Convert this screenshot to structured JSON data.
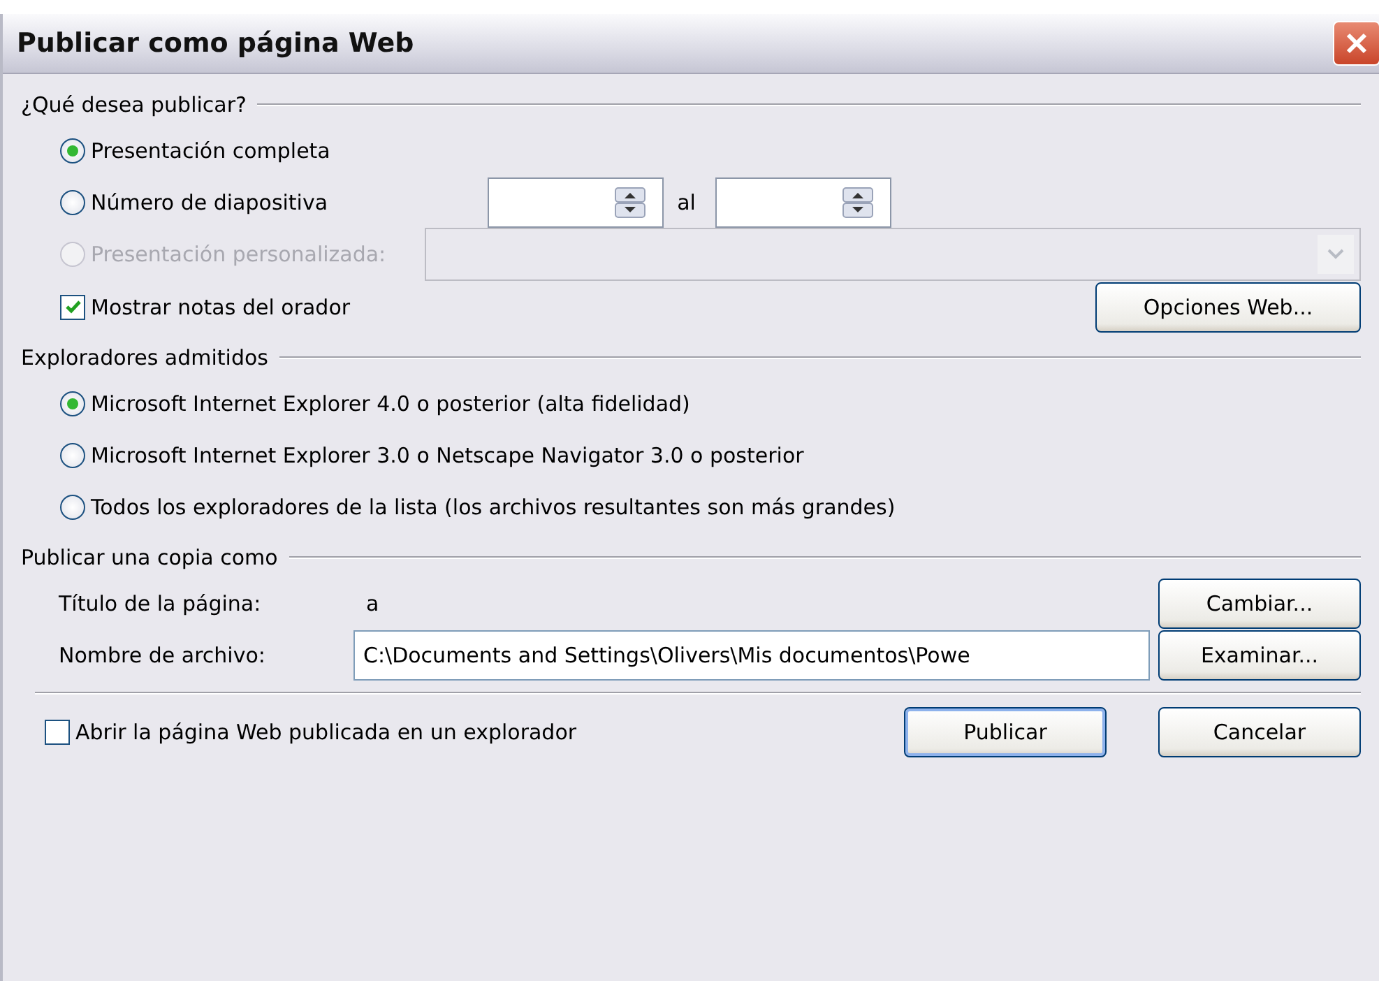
{
  "window": {
    "title": "Publicar como página Web"
  },
  "publish_what": {
    "heading": "¿Qué desea publicar?",
    "options": [
      {
        "kind": "plain",
        "label": "Presentación completa",
        "selected": true,
        "disabled": false
      },
      {
        "kind": "range",
        "label": "Número de diapositiva",
        "selected": false,
        "disabled": false,
        "range_label": "al"
      },
      {
        "kind": "dropdown",
        "label": "Presentación personalizada:",
        "selected": false,
        "disabled": true
      }
    ],
    "notes_checkbox": {
      "label": "Mostrar notas del orador",
      "checked": true
    },
    "web_options_button": "Opciones Web..."
  },
  "browsers": {
    "heading": "Exploradores admitidos",
    "options": [
      {
        "label": "Microsoft Internet Explorer 4.0 o posterior (alta fidelidad)",
        "selected": true
      },
      {
        "label": "Microsoft Internet Explorer 3.0 o Netscape Navigator 3.0 o posterior",
        "selected": false
      },
      {
        "label": "Todos los exploradores de la lista (los archivos resultantes son más grandes)",
        "selected": false
      }
    ]
  },
  "publish_copy": {
    "heading": "Publicar una copia como",
    "page_title": {
      "label": "Título de la página:",
      "value": "a",
      "button": "Cambiar..."
    },
    "file_name": {
      "label": "Nombre de archivo:",
      "value": "C:\\Documents and Settings\\Olivers\\Mis documentos\\Powe",
      "button": "Examinar..."
    }
  },
  "footer": {
    "open_checkbox": {
      "label": "Abrir la página Web publicada en un explorador",
      "checked": false
    },
    "buttons": [
      {
        "label": "Publicar",
        "default": true
      },
      {
        "label": "Cancelar",
        "default": false
      }
    ]
  }
}
